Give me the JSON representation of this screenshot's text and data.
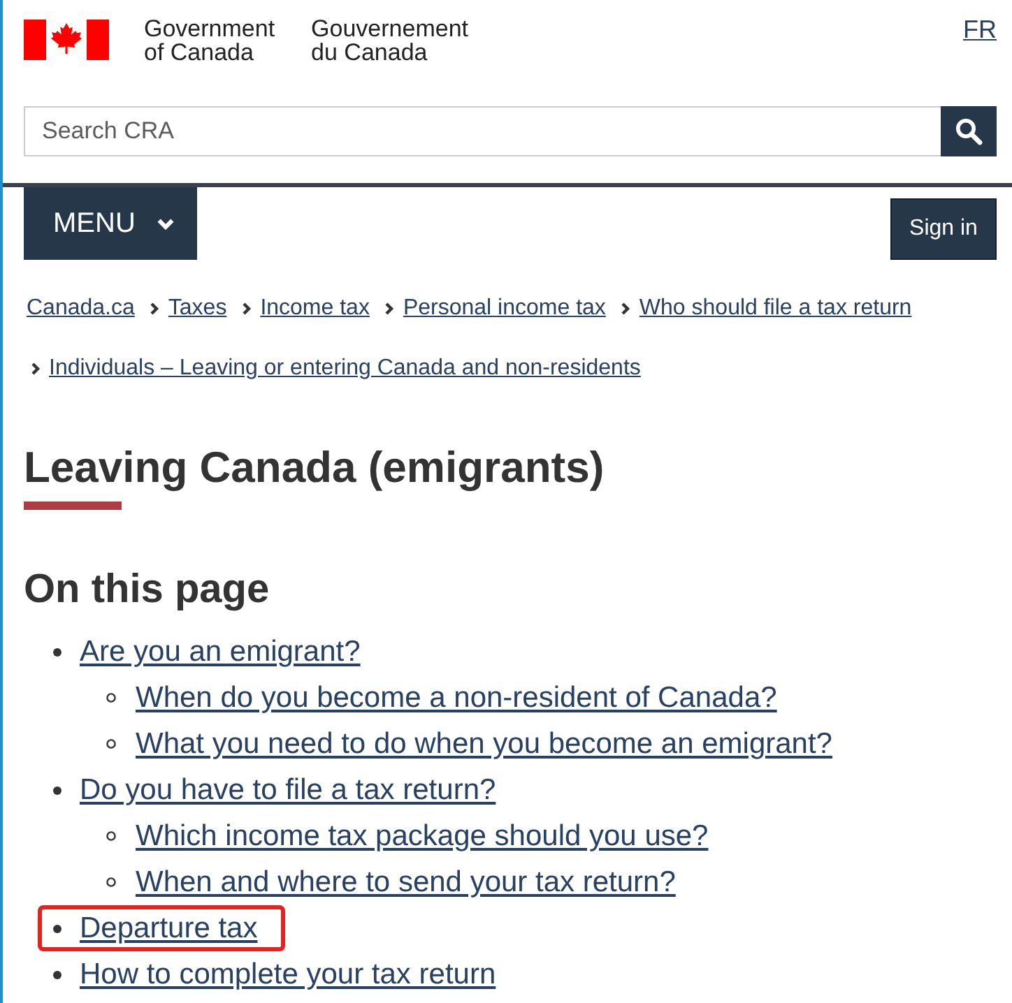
{
  "header": {
    "signature_en": [
      "Government",
      "of Canada"
    ],
    "signature_fr": [
      "Gouvernement",
      "du Canada"
    ],
    "language_link": "FR"
  },
  "search": {
    "placeholder": "Search CRA"
  },
  "nav": {
    "menu_button": "MENU",
    "sign_in_button": "Sign in"
  },
  "breadcrumbs": [
    "Canada.ca",
    "Taxes",
    "Income tax",
    "Personal income tax",
    "Who should file a tax return",
    "Individuals – Leaving or entering Canada and non-residents"
  ],
  "title": "Leaving Canada (emigrants)",
  "on_this_page": {
    "heading": "On this page",
    "items": [
      {
        "label": "Are you an emigrant?",
        "highlighted": false,
        "children": [
          {
            "label": "When do you become a non-resident of Canada?",
            "highlighted": false
          },
          {
            "label": "What you need to do when you become an emigrant?",
            "highlighted": false
          }
        ]
      },
      {
        "label": "Do you have to file a tax return?",
        "highlighted": false,
        "children": [
          {
            "label": "Which income tax package should you use?",
            "highlighted": false
          },
          {
            "label": "When and where to send your tax return?",
            "highlighted": false
          }
        ]
      },
      {
        "label": "Departure tax",
        "highlighted": true
      },
      {
        "label": "How to complete your tax return",
        "highlighted": false
      }
    ]
  }
}
